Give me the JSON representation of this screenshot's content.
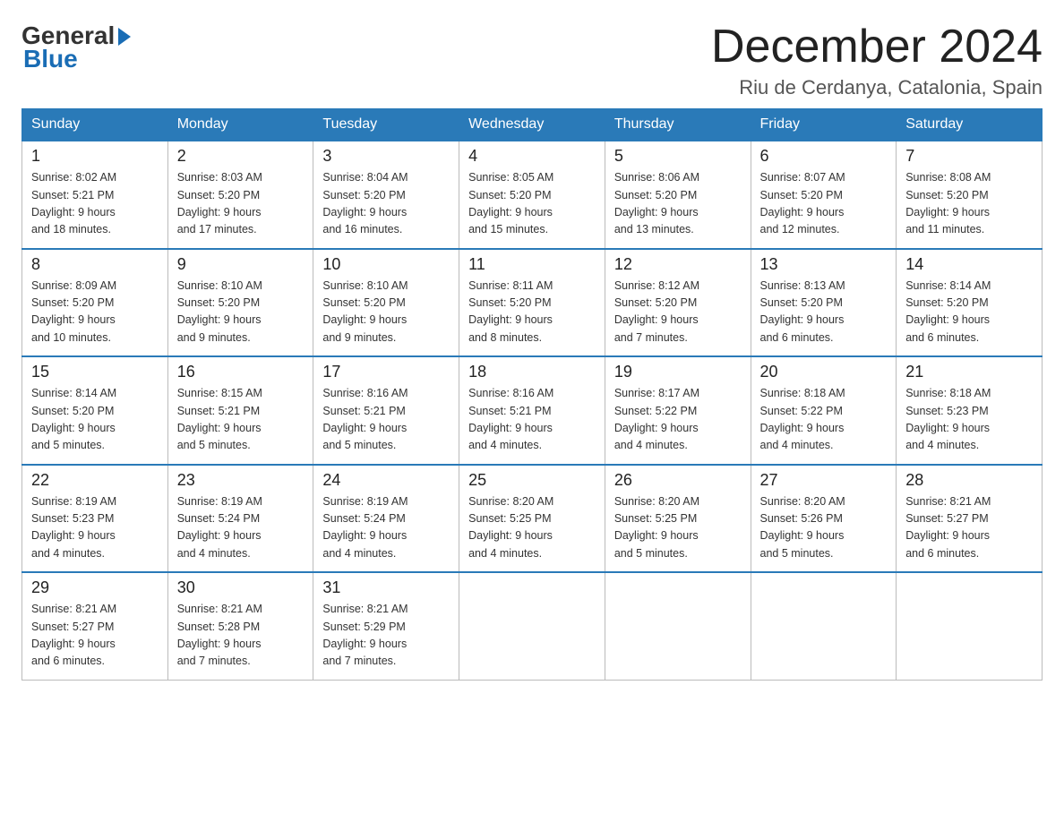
{
  "header": {
    "logo_general": "General",
    "logo_blue": "Blue",
    "title": "December 2024",
    "subtitle": "Riu de Cerdanya, Catalonia, Spain"
  },
  "days_of_week": [
    "Sunday",
    "Monday",
    "Tuesday",
    "Wednesday",
    "Thursday",
    "Friday",
    "Saturday"
  ],
  "weeks": [
    [
      {
        "date": "1",
        "sunrise": "8:02 AM",
        "sunset": "5:21 PM",
        "daylight": "9 hours and 18 minutes."
      },
      {
        "date": "2",
        "sunrise": "8:03 AM",
        "sunset": "5:20 PM",
        "daylight": "9 hours and 17 minutes."
      },
      {
        "date": "3",
        "sunrise": "8:04 AM",
        "sunset": "5:20 PM",
        "daylight": "9 hours and 16 minutes."
      },
      {
        "date": "4",
        "sunrise": "8:05 AM",
        "sunset": "5:20 PM",
        "daylight": "9 hours and 15 minutes."
      },
      {
        "date": "5",
        "sunrise": "8:06 AM",
        "sunset": "5:20 PM",
        "daylight": "9 hours and 13 minutes."
      },
      {
        "date": "6",
        "sunrise": "8:07 AM",
        "sunset": "5:20 PM",
        "daylight": "9 hours and 12 minutes."
      },
      {
        "date": "7",
        "sunrise": "8:08 AM",
        "sunset": "5:20 PM",
        "daylight": "9 hours and 11 minutes."
      }
    ],
    [
      {
        "date": "8",
        "sunrise": "8:09 AM",
        "sunset": "5:20 PM",
        "daylight": "9 hours and 10 minutes."
      },
      {
        "date": "9",
        "sunrise": "8:10 AM",
        "sunset": "5:20 PM",
        "daylight": "9 hours and 9 minutes."
      },
      {
        "date": "10",
        "sunrise": "8:10 AM",
        "sunset": "5:20 PM",
        "daylight": "9 hours and 9 minutes."
      },
      {
        "date": "11",
        "sunrise": "8:11 AM",
        "sunset": "5:20 PM",
        "daylight": "9 hours and 8 minutes."
      },
      {
        "date": "12",
        "sunrise": "8:12 AM",
        "sunset": "5:20 PM",
        "daylight": "9 hours and 7 minutes."
      },
      {
        "date": "13",
        "sunrise": "8:13 AM",
        "sunset": "5:20 PM",
        "daylight": "9 hours and 6 minutes."
      },
      {
        "date": "14",
        "sunrise": "8:14 AM",
        "sunset": "5:20 PM",
        "daylight": "9 hours and 6 minutes."
      }
    ],
    [
      {
        "date": "15",
        "sunrise": "8:14 AM",
        "sunset": "5:20 PM",
        "daylight": "9 hours and 5 minutes."
      },
      {
        "date": "16",
        "sunrise": "8:15 AM",
        "sunset": "5:21 PM",
        "daylight": "9 hours and 5 minutes."
      },
      {
        "date": "17",
        "sunrise": "8:16 AM",
        "sunset": "5:21 PM",
        "daylight": "9 hours and 5 minutes."
      },
      {
        "date": "18",
        "sunrise": "8:16 AM",
        "sunset": "5:21 PM",
        "daylight": "9 hours and 4 minutes."
      },
      {
        "date": "19",
        "sunrise": "8:17 AM",
        "sunset": "5:22 PM",
        "daylight": "9 hours and 4 minutes."
      },
      {
        "date": "20",
        "sunrise": "8:18 AM",
        "sunset": "5:22 PM",
        "daylight": "9 hours and 4 minutes."
      },
      {
        "date": "21",
        "sunrise": "8:18 AM",
        "sunset": "5:23 PM",
        "daylight": "9 hours and 4 minutes."
      }
    ],
    [
      {
        "date": "22",
        "sunrise": "8:19 AM",
        "sunset": "5:23 PM",
        "daylight": "9 hours and 4 minutes."
      },
      {
        "date": "23",
        "sunrise": "8:19 AM",
        "sunset": "5:24 PM",
        "daylight": "9 hours and 4 minutes."
      },
      {
        "date": "24",
        "sunrise": "8:19 AM",
        "sunset": "5:24 PM",
        "daylight": "9 hours and 4 minutes."
      },
      {
        "date": "25",
        "sunrise": "8:20 AM",
        "sunset": "5:25 PM",
        "daylight": "9 hours and 4 minutes."
      },
      {
        "date": "26",
        "sunrise": "8:20 AM",
        "sunset": "5:25 PM",
        "daylight": "9 hours and 5 minutes."
      },
      {
        "date": "27",
        "sunrise": "8:20 AM",
        "sunset": "5:26 PM",
        "daylight": "9 hours and 5 minutes."
      },
      {
        "date": "28",
        "sunrise": "8:21 AM",
        "sunset": "5:27 PM",
        "daylight": "9 hours and 6 minutes."
      }
    ],
    [
      {
        "date": "29",
        "sunrise": "8:21 AM",
        "sunset": "5:27 PM",
        "daylight": "9 hours and 6 minutes."
      },
      {
        "date": "30",
        "sunrise": "8:21 AM",
        "sunset": "5:28 PM",
        "daylight": "9 hours and 7 minutes."
      },
      {
        "date": "31",
        "sunrise": "8:21 AM",
        "sunset": "5:29 PM",
        "daylight": "9 hours and 7 minutes."
      },
      null,
      null,
      null,
      null
    ]
  ],
  "labels": {
    "sunrise": "Sunrise:",
    "sunset": "Sunset:",
    "daylight": "Daylight:"
  }
}
